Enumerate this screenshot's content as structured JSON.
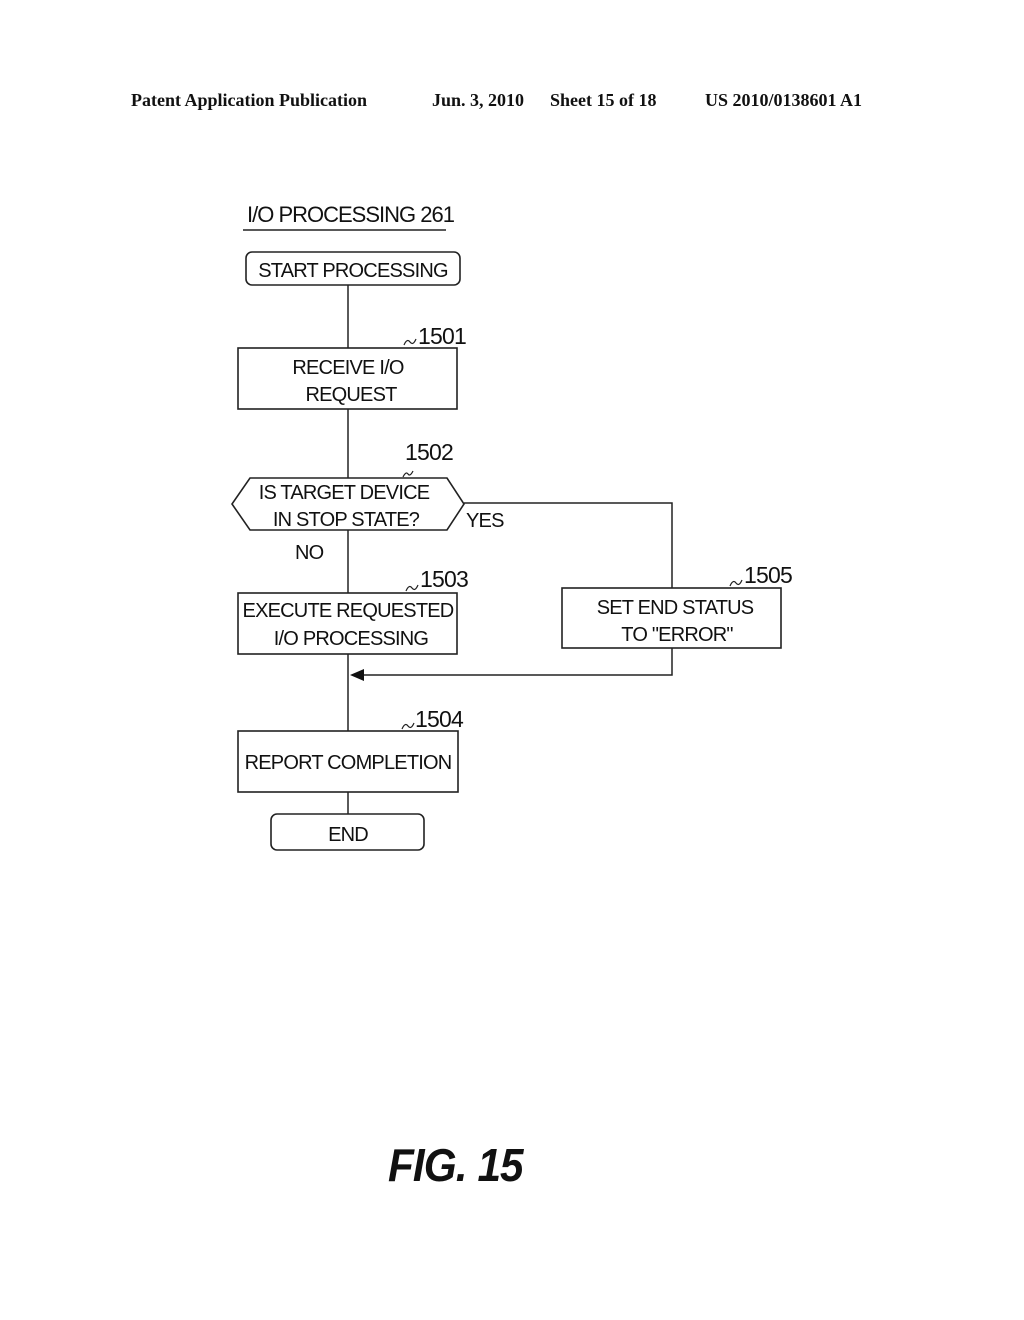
{
  "header": {
    "publication": "Patent Application Publication",
    "date": "Jun. 3, 2010",
    "sheet": "Sheet 15 of 18",
    "patent_number": "US 2010/0138601 A1"
  },
  "diagram": {
    "title": "I/O PROCESSING 261",
    "start": {
      "label": "START PROCESSING"
    },
    "steps": [
      {
        "id": "1501",
        "ref": "1501",
        "lines": [
          "RECEIVE I/O",
          "REQUEST"
        ]
      },
      {
        "id": "1503",
        "ref": "1503",
        "lines": [
          "EXECUTE REQUESTED",
          "I/O PROCESSING"
        ]
      },
      {
        "id": "1505",
        "ref": "1505",
        "lines": [
          "SET END STATUS",
          "TO \"ERROR\""
        ]
      },
      {
        "id": "1504",
        "ref": "1504",
        "lines": [
          "REPORT COMPLETION"
        ]
      }
    ],
    "decision": {
      "id": "1502",
      "ref": "1502",
      "lines": [
        "IS TARGET DEVICE",
        "IN STOP STATE?"
      ],
      "yes_label": "YES",
      "no_label": "NO"
    },
    "end": {
      "label": "END"
    }
  },
  "figure_label": "FIG. 15"
}
